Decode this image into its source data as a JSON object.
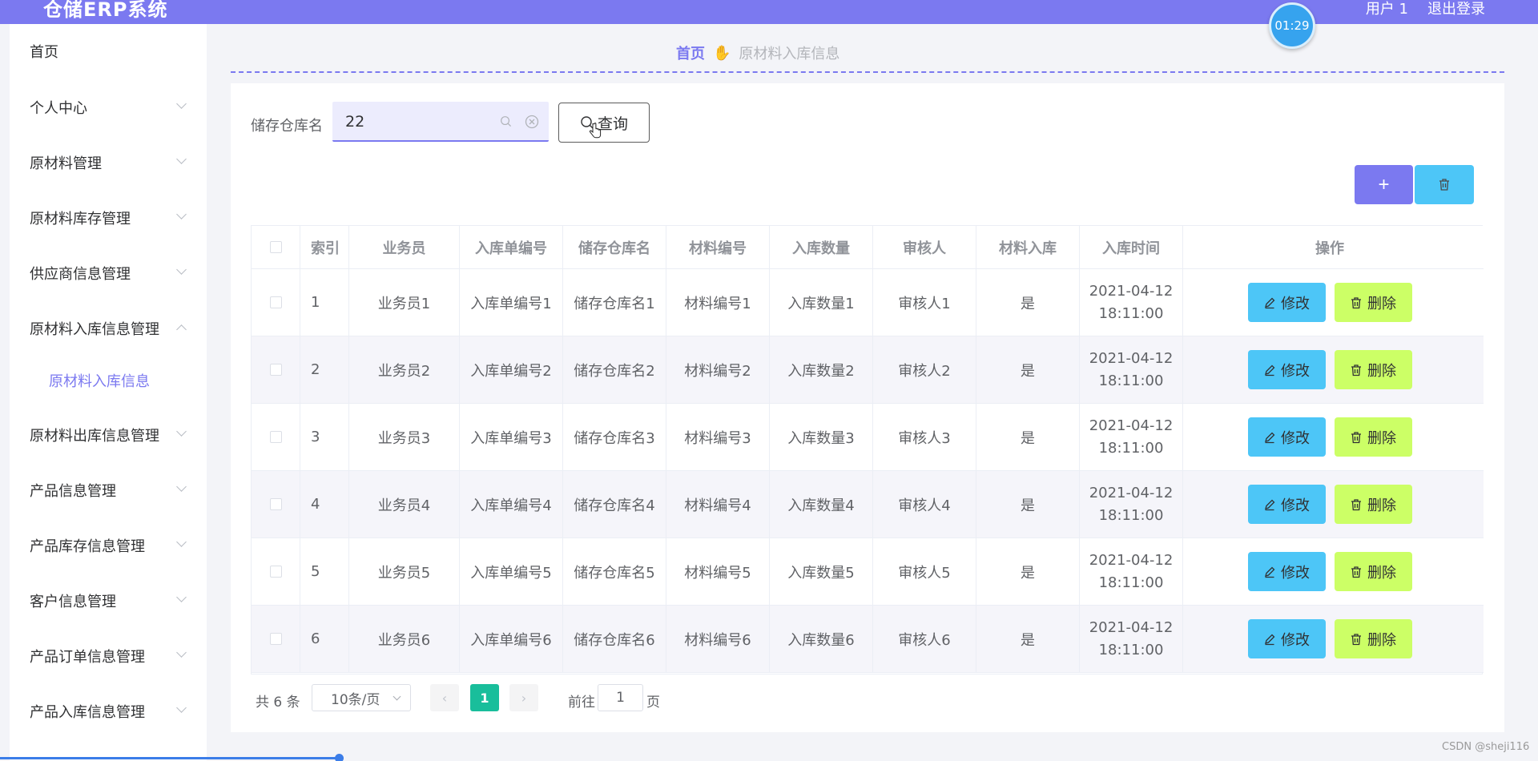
{
  "header": {
    "app_title": "仓储ERP系统",
    "user_label": "用户 1",
    "logout_label": "退出登录",
    "timer": "01:29",
    "brand_color": "#7b79f0"
  },
  "sidebar": {
    "items": [
      {
        "label": "首页",
        "arrow": "none"
      },
      {
        "label": "个人中心",
        "arrow": "chevron-down-icon"
      },
      {
        "label": "原材料管理",
        "arrow": "chevron-down-icon"
      },
      {
        "label": "原材料库存管理",
        "arrow": "chevron-down-icon"
      },
      {
        "label": "供应商信息管理",
        "arrow": "chevron-down-icon"
      },
      {
        "label": "原材料入库信息管理",
        "arrow": "chevron-up-icon"
      },
      {
        "label": "原材料出库信息管理",
        "arrow": "chevron-down-icon"
      },
      {
        "label": "产品信息管理",
        "arrow": "chevron-down-icon"
      },
      {
        "label": "产品库存信息管理",
        "arrow": "chevron-down-icon"
      },
      {
        "label": "客户信息管理",
        "arrow": "chevron-down-icon"
      },
      {
        "label": "产品订单信息管理",
        "arrow": "chevron-down-icon"
      },
      {
        "label": "产品入库信息管理",
        "arrow": "chevron-down-icon"
      }
    ],
    "active_sub": "原材料入库信息"
  },
  "breadcrumb": {
    "home": "首页",
    "current": "原材料入库信息"
  },
  "search": {
    "label": "储存仓库名",
    "value": "22",
    "button_label": "查询"
  },
  "toolbar": {
    "add_label": "+"
  },
  "table": {
    "headers": [
      "索引",
      "业务员",
      "入库单编号",
      "储存仓库名",
      "材料编号",
      "入库数量",
      "审核人",
      "材料入库",
      "入库时间",
      "操作"
    ],
    "edit_label": "修改",
    "delete_label": "删除",
    "rows": [
      {
        "index": "1",
        "staff": "业务员1",
        "order_no": "入库单编号1",
        "warehouse": "储存仓库名1",
        "material_no": "材料编号1",
        "quantity": "入库数量1",
        "reviewer": "审核人1",
        "stocked": "是",
        "date": "2021-04-12",
        "time": "18:11:00"
      },
      {
        "index": "2",
        "staff": "业务员2",
        "order_no": "入库单编号2",
        "warehouse": "储存仓库名2",
        "material_no": "材料编号2",
        "quantity": "入库数量2",
        "reviewer": "审核人2",
        "stocked": "是",
        "date": "2021-04-12",
        "time": "18:11:00"
      },
      {
        "index": "3",
        "staff": "业务员3",
        "order_no": "入库单编号3",
        "warehouse": "储存仓库名3",
        "material_no": "材料编号3",
        "quantity": "入库数量3",
        "reviewer": "审核人3",
        "stocked": "是",
        "date": "2021-04-12",
        "time": "18:11:00"
      },
      {
        "index": "4",
        "staff": "业务员4",
        "order_no": "入库单编号4",
        "warehouse": "储存仓库名4",
        "material_no": "材料编号4",
        "quantity": "入库数量4",
        "reviewer": "审核人4",
        "stocked": "是",
        "date": "2021-04-12",
        "time": "18:11:00"
      },
      {
        "index": "5",
        "staff": "业务员5",
        "order_no": "入库单编号5",
        "warehouse": "储存仓库名5",
        "material_no": "材料编号5",
        "quantity": "入库数量5",
        "reviewer": "审核人5",
        "stocked": "是",
        "date": "2021-04-12",
        "time": "18:11:00"
      },
      {
        "index": "6",
        "staff": "业务员6",
        "order_no": "入库单编号6",
        "warehouse": "储存仓库名6",
        "material_no": "材料编号6",
        "quantity": "入库数量6",
        "reviewer": "审核人6",
        "stocked": "是",
        "date": "2021-04-12",
        "time": "18:11:00"
      }
    ]
  },
  "pagination": {
    "total": "共 6 条",
    "page_size": "10条/页",
    "current_page": "1",
    "goto_label": "前往",
    "goto_value": "1",
    "unit": "页"
  },
  "watermark": "CSDN @sheji116"
}
